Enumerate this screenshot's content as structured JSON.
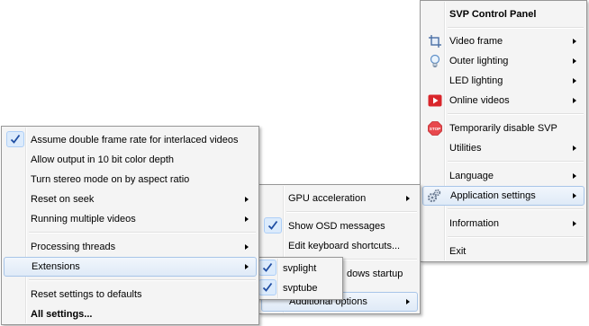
{
  "colors": {
    "menu_background": "#f4f4f4",
    "menu_border": "#979797",
    "highlight_border": "#a8c5e8",
    "check_mark": "#1f4ea3",
    "online_videos_icon": "#d9262b",
    "stop_icon": "#e8484d"
  },
  "control_panel": {
    "title": "SVP Control Panel",
    "items": {
      "video_frame": {
        "label": "Video frame",
        "icon": "crop-frame-icon"
      },
      "outer_lighting": {
        "label": "Outer lighting",
        "icon": "light-bulb-icon"
      },
      "led_lighting": {
        "label": "LED lighting"
      },
      "online_videos": {
        "label": "Online videos",
        "icon": "play-icon"
      },
      "temporarily_disable": {
        "label": "Temporarily disable SVP",
        "icon": "stop-sign-icon",
        "icon_text": "STOP"
      },
      "utilities": {
        "label": "Utilities"
      },
      "language": {
        "label": "Language"
      },
      "application_settings": {
        "label": "Application settings",
        "icon": "gear-icon"
      },
      "information": {
        "label": "Information"
      },
      "exit": {
        "label": "Exit"
      }
    }
  },
  "application_settings_menu": {
    "items": {
      "gpu_acceleration": {
        "label": "GPU acceleration"
      },
      "show_osd_messages": {
        "label": "Show OSD messages",
        "checked": true
      },
      "edit_keyboard_shortcuts": {
        "label": "Edit keyboard shortcuts..."
      },
      "windows_startup": {
        "label_partial": "dows startup"
      },
      "additional_options": {
        "label": "Additional options"
      }
    }
  },
  "additional_options_menu": {
    "items": {
      "assume_double_frame_rate": {
        "label": "Assume double frame rate for interlaced videos",
        "checked": true
      },
      "allow_output_10bit": {
        "label": "Allow output in 10 bit color depth"
      },
      "turn_stereo_mode": {
        "label": "Turn stereo mode on by aspect ratio"
      },
      "reset_on_seek": {
        "label": "Reset on seek"
      },
      "running_multiple_videos": {
        "label": "Running multiple videos"
      },
      "processing_threads": {
        "label": "Processing threads"
      },
      "extensions": {
        "label": "Extensions"
      },
      "reset_settings": {
        "label": "Reset settings to defaults"
      },
      "all_settings": {
        "label": "All settings..."
      }
    }
  },
  "extensions_menu": {
    "items": {
      "svplight": {
        "label": "svplight",
        "checked": true
      },
      "svptube": {
        "label": "svptube",
        "checked": true
      }
    }
  }
}
